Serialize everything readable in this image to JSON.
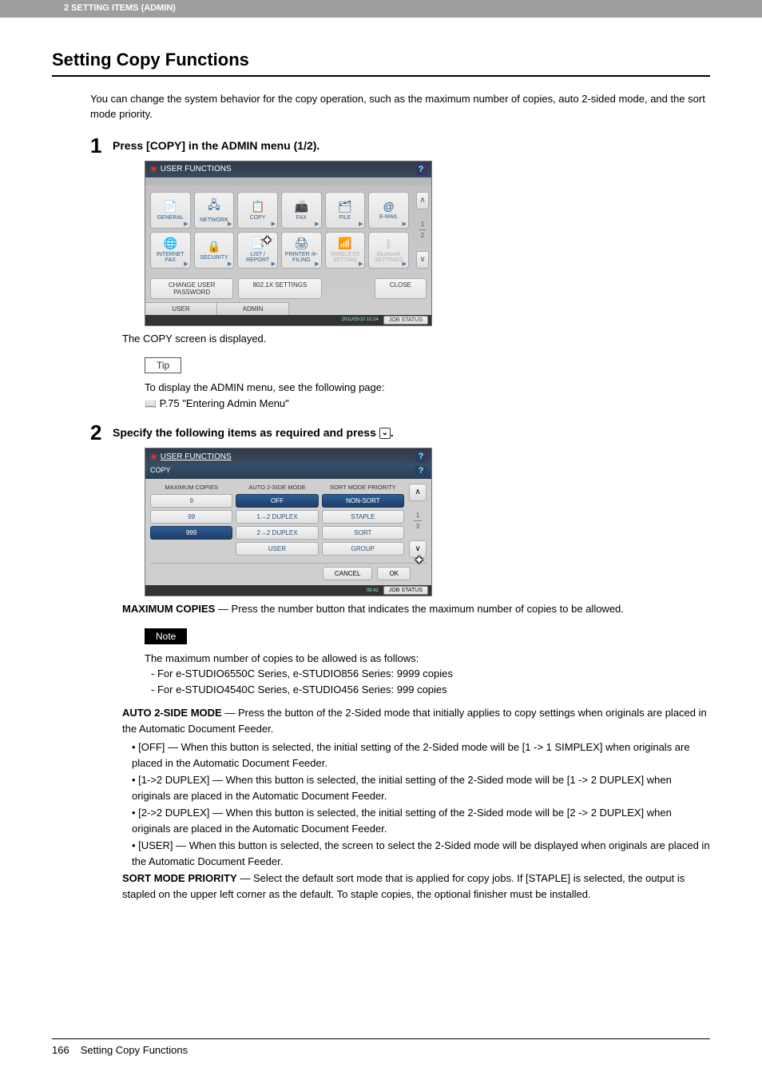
{
  "header": {
    "chapter": "2 SETTING ITEMS (ADMIN)"
  },
  "title": "Setting Copy Functions",
  "intro": "You can change the system behavior for the copy operation, such as the maximum number of copies, auto 2-sided mode, and the sort mode priority.",
  "step1": {
    "num": "1",
    "instruction": "Press [COPY] in the ADMIN menu (1/2).",
    "after_img": "The COPY screen is displayed.",
    "tip_label": "Tip",
    "tip_line1": "To display the ADMIN menu, see the following page:",
    "tip_line2": "P.75 \"Entering Admin Menu\""
  },
  "ss1": {
    "title": "USER FUNCTIONS",
    "help": "?",
    "cells": [
      {
        "icon": "📄",
        "label": "GENERAL",
        "d": false
      },
      {
        "icon": "🖧",
        "label": "NETWORK",
        "d": false
      },
      {
        "icon": "📋",
        "label": "COPY",
        "d": false
      },
      {
        "icon": "📠",
        "label": "FAX",
        "d": false
      },
      {
        "icon": "🗂",
        "label": "FILE",
        "d": false
      },
      {
        "icon": "@",
        "label": "E-MAIL",
        "d": false
      },
      {
        "icon": "🌐",
        "label": "INTERNET FAX",
        "d": false
      },
      {
        "icon": "🔒",
        "label": "SECURITY",
        "d": false
      },
      {
        "icon": "📑",
        "label": "LIST / REPORT",
        "d": false
      },
      {
        "icon": "🖨",
        "label": "PRINTER /e-FILING",
        "d": false
      },
      {
        "icon": "📶",
        "label": "WIRELESS SETTING",
        "d": true
      },
      {
        "icon": "ᛒ",
        "label": "Bluetooth SETTINGS",
        "d": true
      }
    ],
    "page_top": "1",
    "page_bot": "2",
    "btn_changepw": "CHANGE USER PASSWORD",
    "btn_8021x": "802.1X SETTINGS",
    "btn_close": "CLOSE",
    "tab_user": "USER",
    "tab_admin": "ADMIN",
    "timestamp": "2011/05/10\n10:24",
    "job": "JOB STATUS"
  },
  "step2": {
    "num": "2",
    "instruction_pre": "Specify the following items as required and press ",
    "instruction_post": "."
  },
  "ss2": {
    "title": "USER FUNCTIONS",
    "crumb": "COPY",
    "help": "?",
    "col1_head": "MAXIMUM COPIES",
    "col2_head": "AUTO 2-SIDE MODE",
    "col3_head": "SORT MODE PRIORITY",
    "col1": [
      "9",
      "99",
      "999"
    ],
    "col1_sel": 2,
    "col2": [
      "OFF",
      "1→2 DUPLEX",
      "2→2 DUPLEX",
      "USER"
    ],
    "col2_sel": 0,
    "col3": [
      "NON-SORT",
      "STAPLE",
      "SORT",
      "GROUP"
    ],
    "col3_sel": 0,
    "page_top": "1",
    "page_bot": "3",
    "cancel": "CANCEL",
    "ok": "OK",
    "timestamp": "09:42",
    "job": "JOB STATUS"
  },
  "maxcopies": {
    "lead": "MAXIMUM COPIES",
    "text": " — Press the number button that indicates the maximum number of copies to be allowed."
  },
  "note": {
    "label": "Note",
    "intro": "The maximum number of copies to be allowed is as follows:",
    "items": [
      "For e-STUDIO6550C Series, e-STUDIO856 Series: 9999 copies",
      "For e-STUDIO4540C Series, e-STUDIO456 Series: 999 copies"
    ]
  },
  "auto2side": {
    "lead": "AUTO 2-SIDE MODE",
    "text": " — Press the button of the 2-Sided mode that initially applies to copy settings when originals are placed in the Automatic Document Feeder.",
    "items": [
      "[OFF] — When this button is selected, the initial setting of the 2-Sided mode will be [1 -> 1 SIMPLEX] when originals are placed in the Automatic Document Feeder.",
      "[1->2 DUPLEX] — When this button is selected, the initial setting of the 2-Sided mode will be [1 -> 2 DUPLEX] when originals are placed in the Automatic Document Feeder.",
      "[2->2 DUPLEX] — When this button is selected, the initial setting of the 2-Sided mode will be [2 -> 2 DUPLEX] when originals are placed in the Automatic Document Feeder.",
      "[USER] — When this button is selected, the screen to select the 2-Sided mode will be displayed when originals are placed in the Automatic Document Feeder."
    ]
  },
  "sortmode": {
    "lead": "SORT MODE PRIORITY",
    "text": " — Select the default sort mode that is applied for copy jobs. If [STAPLE] is selected, the output is stapled on the upper left corner as the default. To staple copies, the optional finisher must be installed."
  },
  "footer": {
    "pageno": "166",
    "title": "Setting Copy Functions"
  }
}
